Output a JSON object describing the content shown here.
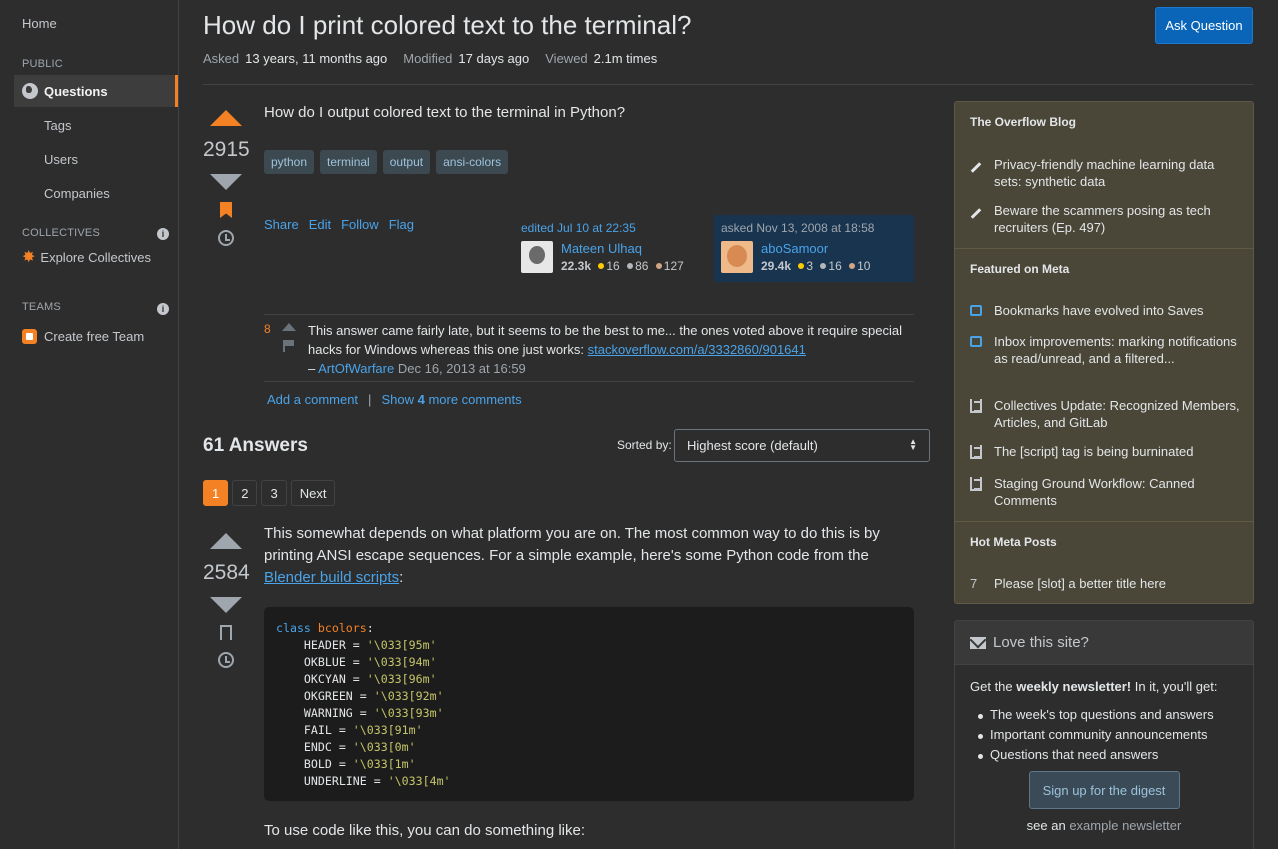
{
  "sidebar": {
    "home": "Home",
    "public_label": "PUBLIC",
    "questions": "Questions",
    "tags": "Tags",
    "users": "Users",
    "companies": "Companies",
    "collectives_label": "COLLECTIVES",
    "explore_collectives": "Explore Collectives",
    "teams_label": "TEAMS",
    "create_team": "Create free Team",
    "info_glyph": "i"
  },
  "question": {
    "title": "How do I print colored text to the terminal?",
    "ask_button": "Ask Question",
    "asked_label": "Asked",
    "asked_value": "13 years, 11 months ago",
    "modified_label": "Modified",
    "modified_value": "17 days ago",
    "viewed_label": "Viewed",
    "viewed_value": "2.1m times",
    "votes": "2915",
    "body": "How do I output colored text to the terminal in Python?",
    "tags": [
      "python",
      "terminal",
      "output",
      "ansi-colors"
    ],
    "menu": [
      "Share",
      "Edit",
      "Follow",
      "Flag"
    ],
    "editor": {
      "action": "edited Jul 10 at 22:35",
      "name": "Mateen Ulhaq",
      "rep": "22.3k",
      "gold": "16",
      "silver": "86",
      "bronze": "127"
    },
    "owner": {
      "action": "asked Nov 13, 2008 at 18:58",
      "name": "aboSamoor",
      "rep": "29.4k",
      "gold": "3",
      "silver": "16",
      "bronze": "10"
    }
  },
  "comment": {
    "score": "8",
    "text": "This answer came fairly late, but it seems to be the best to me... the ones voted above it require special hacks for Windows whereas this one just works: ",
    "link": "stackoverflow.com/a/3332860/901641",
    "dash": "–",
    "user": "ArtOfWarfare",
    "date": "Dec 16, 2013 at 16:59",
    "add_comment": "Add a comment",
    "separator": "|",
    "show_prefix": "Show",
    "show_count": "4",
    "show_suffix": "more comments"
  },
  "answers": {
    "count_label": "61 Answers",
    "sorted_label": "Sorted by:",
    "sort_value": "Highest score (default)",
    "pages": [
      "1",
      "2",
      "3",
      "Next"
    ]
  },
  "answer": {
    "votes": "2584",
    "text_before": "This somewhat depends on what platform you are on. The most common way to do this is by printing ANSI escape sequences. For a simple example, here's some Python code from the ",
    "link": "Blender build scripts",
    "text_after": ":",
    "code_kw": "class",
    "code_cls": "bcolors",
    "code_colon": ":",
    "code_lines": [
      {
        "name": "HEADER",
        "eq": " = ",
        "val": "'\\033[95m'"
      },
      {
        "name": "OKBLUE",
        "eq": " = ",
        "val": "'\\033[94m'"
      },
      {
        "name": "OKCYAN",
        "eq": " = ",
        "val": "'\\033[96m'"
      },
      {
        "name": "OKGREEN",
        "eq": " = ",
        "val": "'\\033[92m'"
      },
      {
        "name": "WARNING",
        "eq": " = ",
        "val": "'\\033[93m'"
      },
      {
        "name": "FAIL",
        "eq": " = ",
        "val": "'\\033[91m'"
      },
      {
        "name": "ENDC",
        "eq": " = ",
        "val": "'\\033[0m'"
      },
      {
        "name": "BOLD",
        "eq": " = ",
        "val": "'\\033[1m'"
      },
      {
        "name": "UNDERLINE",
        "eq": " = ",
        "val": "'\\033[4m'"
      }
    ],
    "text2": "To use code like this, you can do something like:"
  },
  "right": {
    "blog_title": "The Overflow Blog",
    "blog_items": [
      "Privacy-friendly machine learning data sets: synthetic data",
      "Beware the scammers posing as tech recruiters (Ep. 497)"
    ],
    "meta_title": "Featured on Meta",
    "meta_items": [
      "Bookmarks have evolved into Saves",
      "Inbox improvements: marking notifications as read/unread, and a filtered...",
      "Collectives Update: Recognized Members, Articles, and GitLab",
      "The [script] tag is being burninated",
      "Staging Ground Workflow: Canned Comments"
    ],
    "hot_title": "Hot Meta Posts",
    "hot_items": [
      {
        "num": "7",
        "text": "Please [slot] a better title here"
      }
    ],
    "love_title": "Love this site?",
    "love_intro_prefix": "Get the ",
    "love_intro_bold": "weekly newsletter!",
    "love_intro_suffix": " In it, you'll get:",
    "love_items": [
      "The week's top questions and answers",
      "Important community announcements",
      "Questions that need answers"
    ],
    "digest_button": "Sign up for the digest",
    "see_prefix": "see an ",
    "see_link": "example newsletter"
  },
  "colors": {
    "accent": "#f48225",
    "link": "#4aa3e9",
    "primary_button": "#0a65b8",
    "background": "#2d2d2d",
    "blog_panel": "#4a4739"
  },
  "icons": [
    "globe-icon",
    "info-icon",
    "collectives-icon",
    "team-icon",
    "upvote-icon",
    "downvote-icon",
    "bookmark-icon",
    "history-icon",
    "flag-icon",
    "pencil-icon",
    "chat-icon",
    "stack-icon",
    "mail-icon"
  ]
}
